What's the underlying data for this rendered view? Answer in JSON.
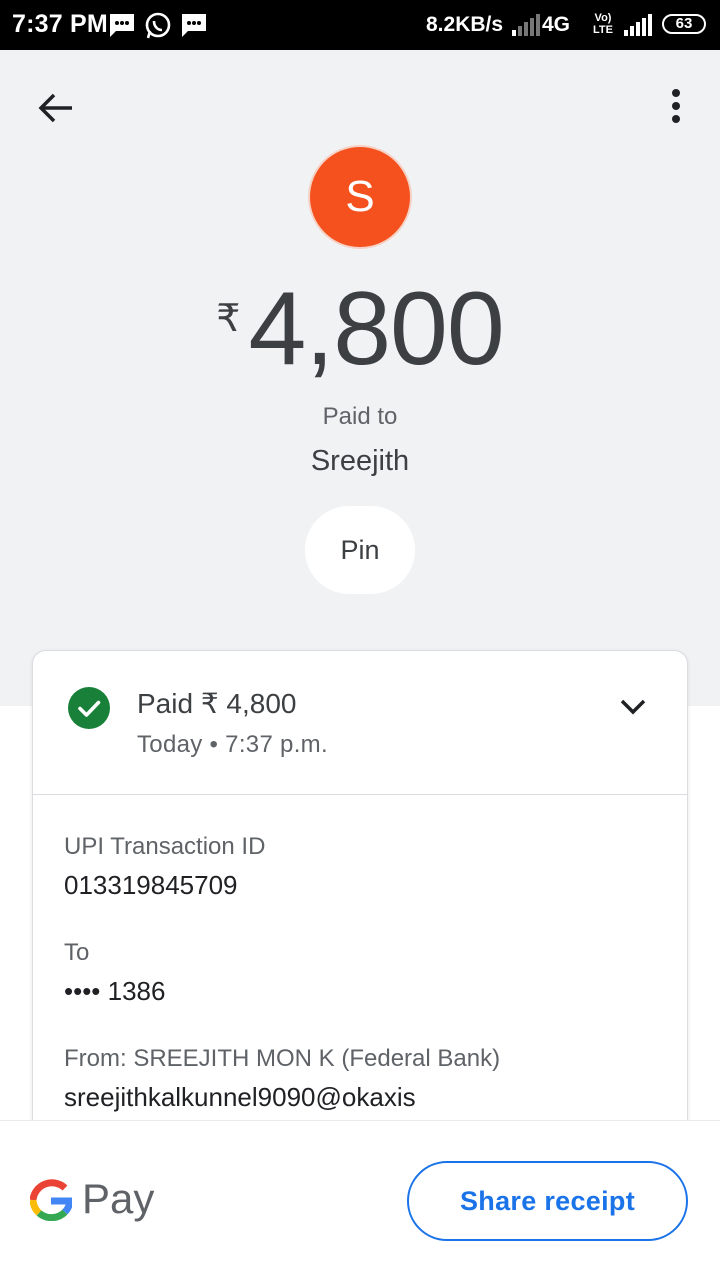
{
  "status_bar": {
    "time": "7:37 PM",
    "speed": "8.2KB/s",
    "network": "4G",
    "volte": "Vo) LTE",
    "battery": "63"
  },
  "header": {
    "avatar_letter": "S",
    "avatar_color": "#f4511e",
    "currency_symbol": "₹",
    "amount": "4,800",
    "paid_to_label": "Paid to",
    "payee_name": "Sreejith",
    "pin_label": "Pin"
  },
  "card": {
    "status_title": "Paid ₹ 4,800",
    "status_time": "Today • 7:37 p.m.",
    "status_color": "#188038",
    "details": [
      {
        "label": "UPI Transaction ID",
        "value": "013319845709"
      },
      {
        "label": "To",
        "value": "•••• 1386"
      },
      {
        "label": "From: SREEJITH MON K (Federal Bank)",
        "value": "sreejithkalkunnel9090@okaxis"
      }
    ]
  },
  "footer": {
    "brand_text": "Pay",
    "share_label": "Share receipt",
    "accent_color": "#1a73e8"
  }
}
